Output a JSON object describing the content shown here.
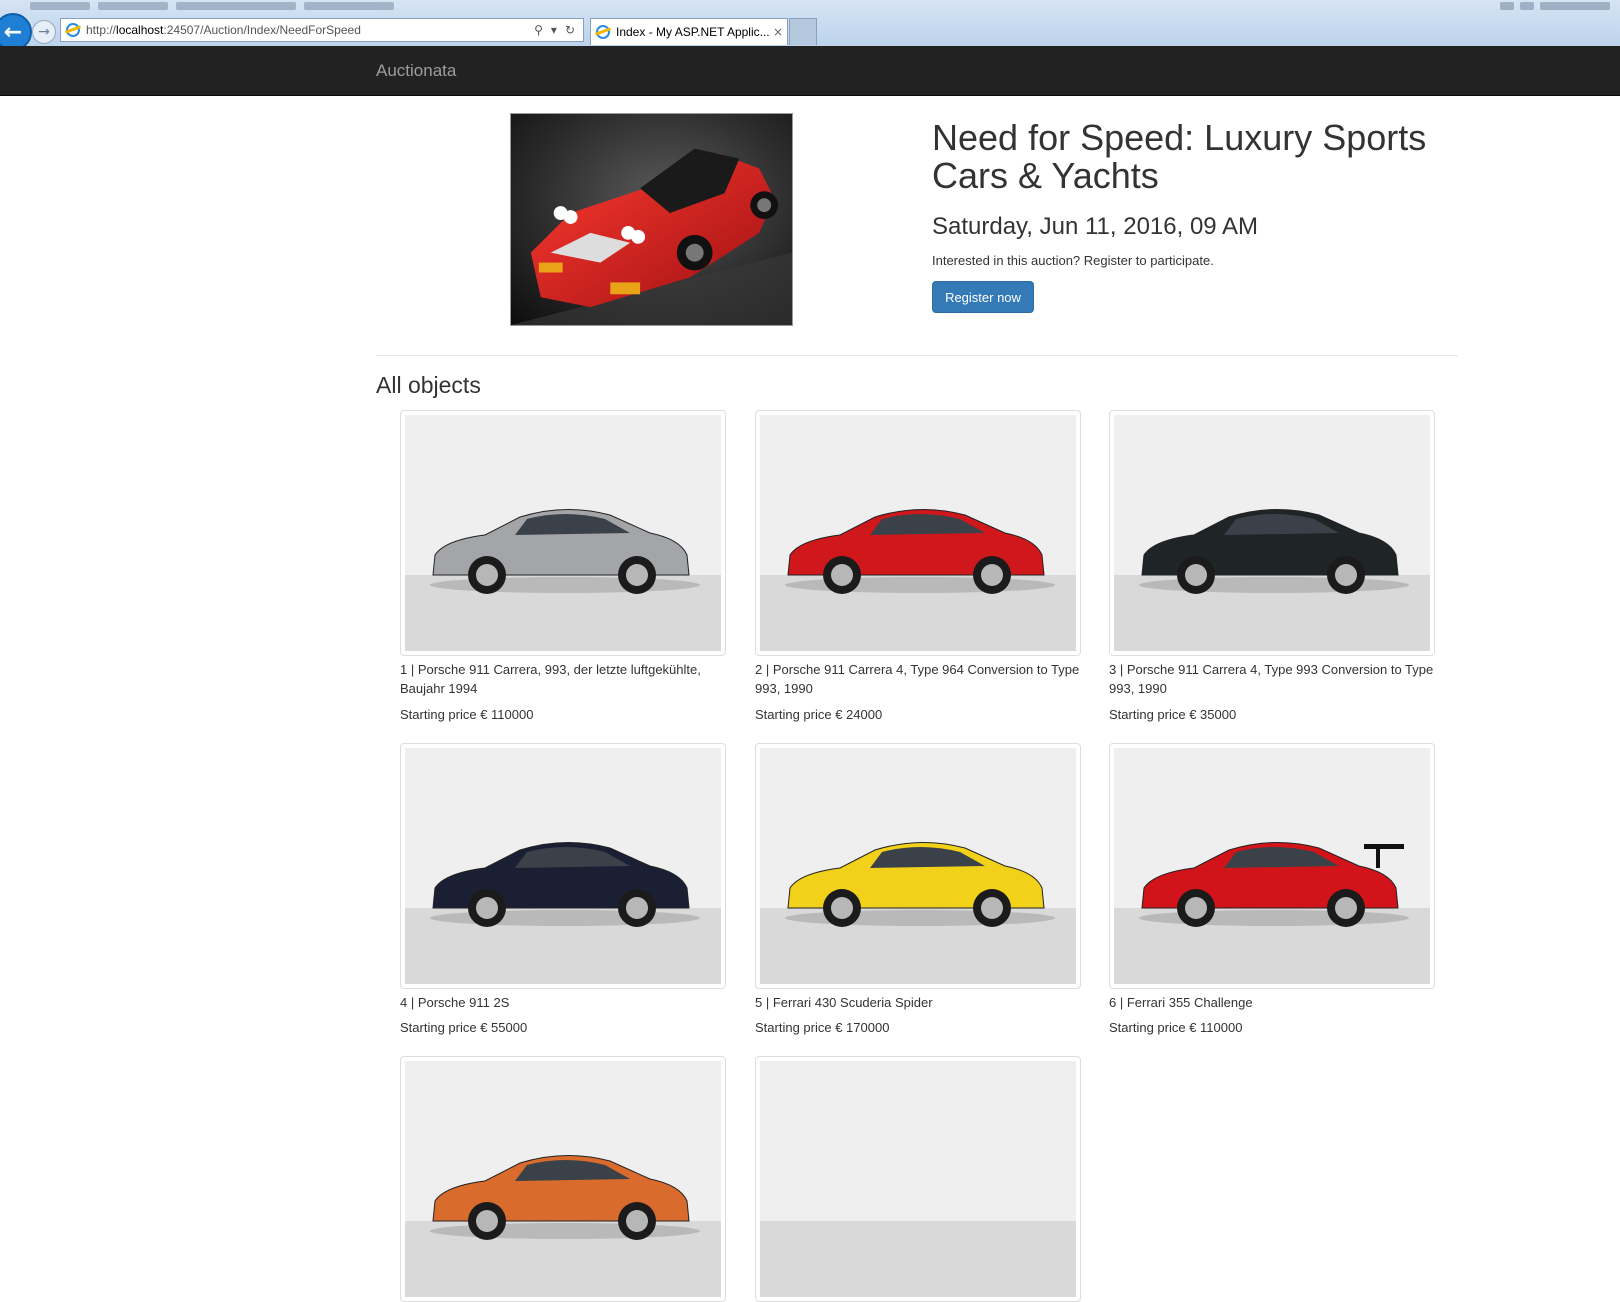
{
  "browser": {
    "url_prefix": "http://",
    "url_host": "localhost",
    "url_rest": ":24507/Auction/Index/NeedForSpeed",
    "tab_title": "Index - My ASP.NET Applic...",
    "tab_close": "×",
    "back_glyph": "←",
    "forward_glyph": "→",
    "search_glyph": "⚲",
    "dropdown_glyph": "▾",
    "refresh_glyph": "↻"
  },
  "navbar": {
    "brand": "Auctionata"
  },
  "auction": {
    "title": "Need for Speed: Luxury Sports Cars & Yachts",
    "date": "Saturday, Jun 11, 2016, 09 AM",
    "info": "Interested in this auction? Register to participate.",
    "register_label": "Register now"
  },
  "objects": {
    "heading": "All objects",
    "items": [
      {
        "title": "1 | Porsche 911 Carrera, 993, der letzte luftgekühlte, Baujahr 1994",
        "price": "Starting price € 110000",
        "car_color": "#a3a5a8",
        "wing": false
      },
      {
        "title": "2 | Porsche 911 Carrera 4, Type 964 Conversion to Type 993, 1990",
        "price": "Starting price € 24000",
        "car_color": "#d0181c",
        "wing": false
      },
      {
        "title": "3 | Porsche 911 Carrera 4, Type 993 Conversion to Type 993, 1990",
        "price": "Starting price € 35000",
        "car_color": "#1f2426",
        "wing": false
      },
      {
        "title": "4 | Porsche 911 2S",
        "price": "Starting price € 55000",
        "car_color": "#1a1f33",
        "wing": false
      },
      {
        "title": "5 | Ferrari 430 Scuderia Spider",
        "price": "Starting price € 170000",
        "car_color": "#f2d11a",
        "wing": false
      },
      {
        "title": "6 | Ferrari 355 Challenge",
        "price": "Starting price € 110000",
        "car_color": "#d2141a",
        "wing": true
      },
      {
        "title": "",
        "price": "",
        "car_color": "#d96b2c",
        "wing": false
      },
      {
        "title": "",
        "price": "",
        "car_color": "",
        "wing": false
      }
    ]
  },
  "colors": {
    "navbar_bg": "#222222",
    "brand_text": "#9d9d9d",
    "button_primary": "#337ab7",
    "hero_car": "#d61e22"
  }
}
